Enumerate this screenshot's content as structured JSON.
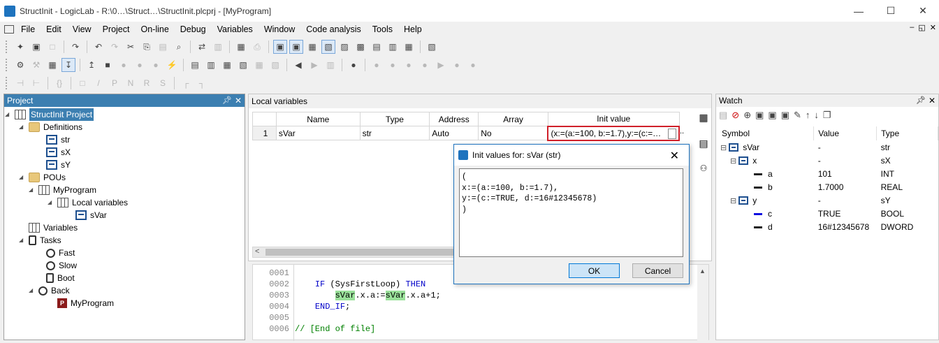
{
  "window": {
    "title": "StructInit - LogicLab - R:\\0…\\Struct…\\StructInit.plcprj - [MyProgram]",
    "minimize": "—",
    "maximize": "☐",
    "close": "✕"
  },
  "menu": [
    "File",
    "Edit",
    "View",
    "Project",
    "On-line",
    "Debug",
    "Variables",
    "Window",
    "Code analysis",
    "Tools",
    "Help"
  ],
  "mdi_controls": [
    "–",
    "◱",
    "✕"
  ],
  "toolbar1": [
    "✦",
    "▣",
    "□",
    "↷",
    "↶",
    "↷",
    "✂",
    "⎘",
    "▤",
    "⌕",
    "⇄",
    "▥",
    "▦",
    "⎙",
    "▣",
    "▣",
    "▦",
    "▧",
    "▨",
    "▩",
    "▤",
    "▥",
    "▦",
    "▧"
  ],
  "toolbar2": [
    "⚙",
    "⚒",
    "▦",
    "↧",
    "↥",
    "■",
    "●",
    "●",
    "●",
    "⚡",
    "▤",
    "▥",
    "▦",
    "▧",
    "▦",
    "▧",
    "◀",
    "▶",
    "▥",
    "●",
    "●",
    "●",
    "●",
    "●",
    "▶",
    "●",
    "●"
  ],
  "toolbar3": [
    "⊣",
    "⊢",
    "{}",
    "□",
    "/",
    "P",
    "N",
    "R",
    "S",
    "┌",
    "┐"
  ],
  "project": {
    "title": "Project",
    "tree": [
      {
        "label": "StructInit Project",
        "icon": "project-icon",
        "selected": true
      },
      {
        "label": "Definitions",
        "icon": "folder-icon"
      },
      {
        "label": "str",
        "icon": "struct-icon"
      },
      {
        "label": "sX",
        "icon": "struct-icon"
      },
      {
        "label": "sY",
        "icon": "struct-icon"
      },
      {
        "label": "POUs",
        "icon": "folder-icon"
      },
      {
        "label": "MyProgram",
        "icon": "program-icon"
      },
      {
        "label": "Local variables",
        "icon": "variables-grid-icon"
      },
      {
        "label": "sVar",
        "icon": "struct-icon"
      },
      {
        "label": "Variables",
        "icon": "global-variables-icon"
      },
      {
        "label": "Tasks",
        "icon": "tasks-icon"
      },
      {
        "label": "Fast",
        "icon": "clock-icon"
      },
      {
        "label": "Slow",
        "icon": "clock-icon"
      },
      {
        "label": "Boot",
        "icon": "boot-icon"
      },
      {
        "label": "Back",
        "icon": "clock-icon"
      },
      {
        "label": "MyProgram",
        "icon": "program-p-icon"
      }
    ]
  },
  "local_vars": {
    "title": "Local variables",
    "columns": [
      "",
      "Name",
      "Type",
      "Address",
      "Array",
      "Init value"
    ],
    "rows": [
      {
        "num": "1",
        "name": "sVar",
        "type": "str",
        "address": "Auto",
        "array": "No",
        "init": "(x:=(a:=100, b:=1.7),y:=(c:=…"
      }
    ],
    "ellipsis": ".."
  },
  "code": [
    {
      "n": "0001",
      "parts": [
        {
          "t": ""
        }
      ]
    },
    {
      "n": "0002",
      "parts": [
        {
          "t": "    "
        },
        {
          "t": "IF",
          "c": "kw"
        },
        {
          "t": " (SysFirstLoop) "
        },
        {
          "t": "THEN",
          "c": "kw"
        }
      ]
    },
    {
      "n": "0003",
      "parts": [
        {
          "t": "        "
        },
        {
          "t": "sVar",
          "c": "hl"
        },
        {
          "t": ".x.a:="
        },
        {
          "t": "sVar",
          "c": "hl"
        },
        {
          "t": ".x.a+1;"
        }
      ]
    },
    {
      "n": "0004",
      "parts": [
        {
          "t": "    "
        },
        {
          "t": "END_IF",
          "c": "kw"
        },
        {
          "t": ";"
        }
      ]
    },
    {
      "n": "0005",
      "parts": [
        {
          "t": ""
        }
      ]
    },
    {
      "n": "0006",
      "parts": [
        {
          "t": "// [End of file]",
          "c": "cm"
        }
      ]
    }
  ],
  "dialog": {
    "title": "Init values for: sVar (str)",
    "text": "(\nx:=(a:=100, b:=1.7),\ny:=(c:=TRUE, d:=16#12345678)\n)",
    "ok": "OK",
    "cancel": "Cancel"
  },
  "watch": {
    "title": "Watch",
    "columns": [
      "Symbol",
      "Value",
      "Type"
    ],
    "rows": [
      {
        "symbol": "sVar",
        "value": "-",
        "type": "str"
      },
      {
        "symbol": "x",
        "value": "-",
        "type": "sX"
      },
      {
        "symbol": "a",
        "value": "101",
        "type": "INT"
      },
      {
        "symbol": "b",
        "value": "1.7000",
        "type": "REAL"
      },
      {
        "symbol": "y",
        "value": "-",
        "type": "sY"
      },
      {
        "symbol": "c",
        "value": "TRUE",
        "type": "BOOL"
      },
      {
        "symbol": "d",
        "value": "16#12345678",
        "type": "DWORD"
      }
    ]
  }
}
